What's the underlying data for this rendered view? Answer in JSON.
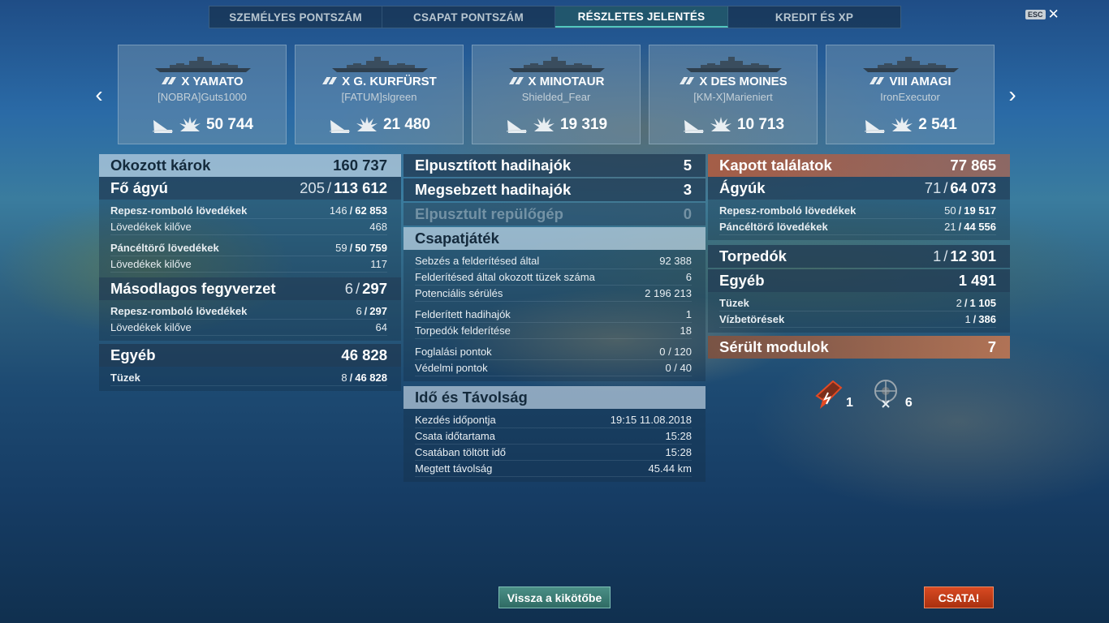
{
  "tabs": [
    {
      "label": "SZEMÉLYES PONTSZÁM",
      "active": false
    },
    {
      "label": "CSAPAT PONTSZÁM",
      "active": false
    },
    {
      "label": "RÉSZLETES JELENTÉS",
      "active": true
    },
    {
      "label": "KREDIT ÉS XP",
      "active": false
    }
  ],
  "esc": {
    "key": "ESC",
    "close": "✕"
  },
  "nav": {
    "prev": "‹",
    "next": "›"
  },
  "ships": [
    {
      "tier": "X YAMATO",
      "player": "[NOBRA]Guts1000",
      "damage": "50 744"
    },
    {
      "tier": "X G. KURFÜRST",
      "player": "[FATUM]slgreen",
      "damage": "21 480"
    },
    {
      "tier": "X MINOTAUR",
      "player": "Shielded_Fear",
      "damage": "19 319"
    },
    {
      "tier": "X DES MOINES",
      "player": "[KM-X]Marieniert",
      "damage": "10 713"
    },
    {
      "tier": "VIII AMAGI",
      "player": "IronExecutor",
      "damage": "2 541"
    }
  ],
  "left": {
    "caused": {
      "label": "Okozott károk",
      "value": "160 737"
    },
    "main": {
      "label": "Fő ágyú",
      "hits": "205",
      "value": "113 612"
    },
    "he": {
      "label": "Repesz-romboló lövedékek",
      "hits": "146",
      "value": "62 853"
    },
    "he_fired": {
      "label": "Lövedékek kilőve",
      "value": "468"
    },
    "ap": {
      "label": "Páncéltörő lövedékek",
      "hits": "59",
      "value": "50 759"
    },
    "ap_fired": {
      "label": "Lövedékek kilőve",
      "value": "117"
    },
    "secondary": {
      "label": "Másodlagos fegyverzet",
      "hits": "6",
      "value": "297"
    },
    "sec_he": {
      "label": "Repesz-romboló lövedékek",
      "hits": "6",
      "value": "297"
    },
    "sec_fired": {
      "label": "Lövedékek kilőve",
      "value": "64"
    },
    "other": {
      "label": "Egyéb",
      "value": "46 828"
    },
    "fires": {
      "label": "Tüzek",
      "hits": "8",
      "value": "46 828"
    }
  },
  "middle": {
    "destroyed": {
      "label": "Elpusztított hadihajók",
      "value": "5"
    },
    "damaged": {
      "label": "Megsebzett hadihajók",
      "value": "3"
    },
    "planes": {
      "label": "Elpusztult repülőgép",
      "value": "0"
    },
    "team": {
      "label": "Csapatjáték"
    },
    "spot_dmg": {
      "label": "Sebzés a felderítésed által",
      "value": "92 388"
    },
    "spot_fires": {
      "label": "Felderítésed által okozott tüzek száma",
      "value": "6"
    },
    "potential": {
      "label": "Potenciális sérülés",
      "value": "2 196 213"
    },
    "spotted": {
      "label": "Felderített hadihajók",
      "value": "1"
    },
    "torp_spot": {
      "label": "Torpedók felderítése",
      "value": "18"
    },
    "capture": {
      "label": "Foglalási pontok",
      "value": "0 / 120"
    },
    "defense": {
      "label": "Védelmi pontok",
      "value": "0 / 40"
    },
    "time": {
      "label": "Idő és Távolság"
    },
    "start": {
      "label": "Kezdés időpontja",
      "value": "19:15  11.08.2018"
    },
    "duration": {
      "label": "Csata időtartama",
      "value": "15:28"
    },
    "in_battle": {
      "label": "Csatában töltött idő",
      "value": "15:28"
    },
    "distance": {
      "label": "Megtett távolság",
      "value": "45.44 km"
    }
  },
  "right": {
    "received": {
      "label": "Kapott találatok",
      "value": "77 865"
    },
    "guns": {
      "label": "Ágyúk",
      "hits": "71",
      "value": "64 073"
    },
    "he": {
      "label": "Repesz-romboló lövedékek",
      "hits": "50",
      "value": "19 517"
    },
    "ap": {
      "label": "Páncéltörő lövedékek",
      "hits": "21",
      "value": "44 556"
    },
    "torps": {
      "label": "Torpedók",
      "hits": "1",
      "value": "12 301"
    },
    "other": {
      "label": "Egyéb",
      "value": "1 491"
    },
    "fires": {
      "label": "Tüzek",
      "hits": "2",
      "value": "1 105"
    },
    "floods": {
      "label": "Vízbetörések",
      "hits": "1",
      "value": "386"
    },
    "modules": {
      "label": "Sérült modulok",
      "value": "7"
    },
    "mod_items": [
      {
        "icon": "damaged-turret-icon",
        "count": "1"
      },
      {
        "icon": "destroyed-module-icon",
        "count": "6"
      }
    ]
  },
  "buttons": {
    "port": "Vissza a kikötőbe",
    "battle": "CSATA!"
  }
}
